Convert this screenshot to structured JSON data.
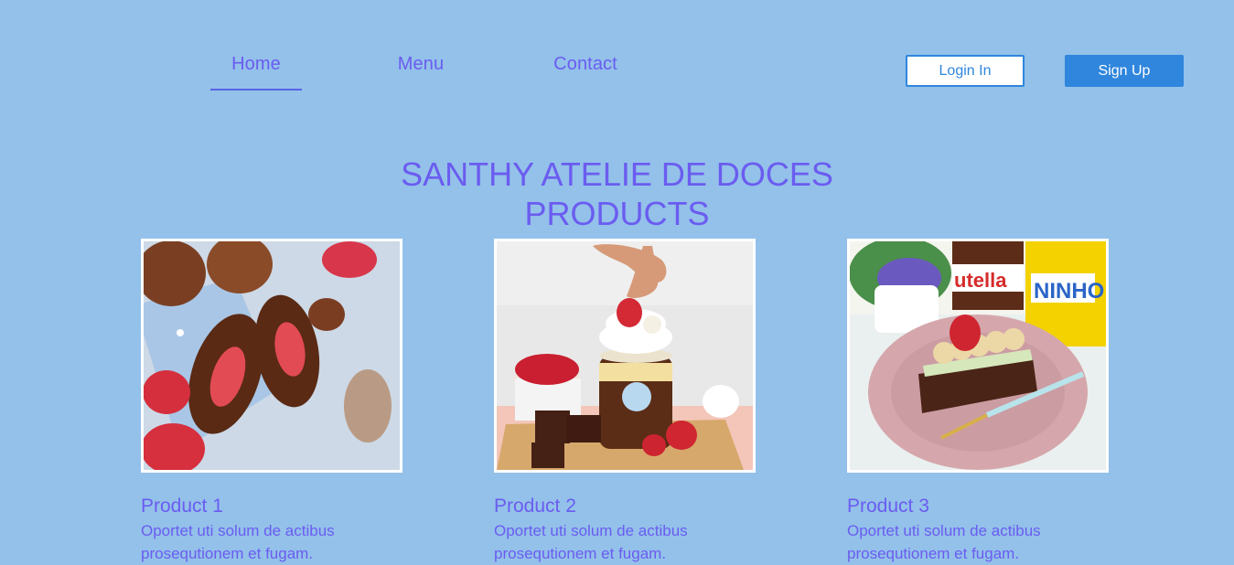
{
  "nav": {
    "home": "Home",
    "menu": "Menu",
    "contact": "Contact"
  },
  "auth": {
    "login": "Login In",
    "signup": "Sign Up"
  },
  "hero": {
    "line1": "SANTHY ATELIE DE DOCES",
    "line2": "PRODUCTS"
  },
  "products": [
    {
      "name": "Product 1",
      "description": "Oportet uti solum de actibus prosequtionem et fugam."
    },
    {
      "name": "Product 2",
      "description": "Oportet uti solum de actibus prosequtionem et fugam."
    },
    {
      "name": "Product 3",
      "description": "Oportet uti solum de actibus prosequtionem et fugam."
    }
  ],
  "images": {
    "product3_jar_left": "utella",
    "product3_jar_right": "NINHO"
  },
  "colors": {
    "background": "#93c1ea",
    "accent": "#6b5cf0",
    "button_blue": "#2f86dc",
    "image_border": "#ffffff"
  }
}
